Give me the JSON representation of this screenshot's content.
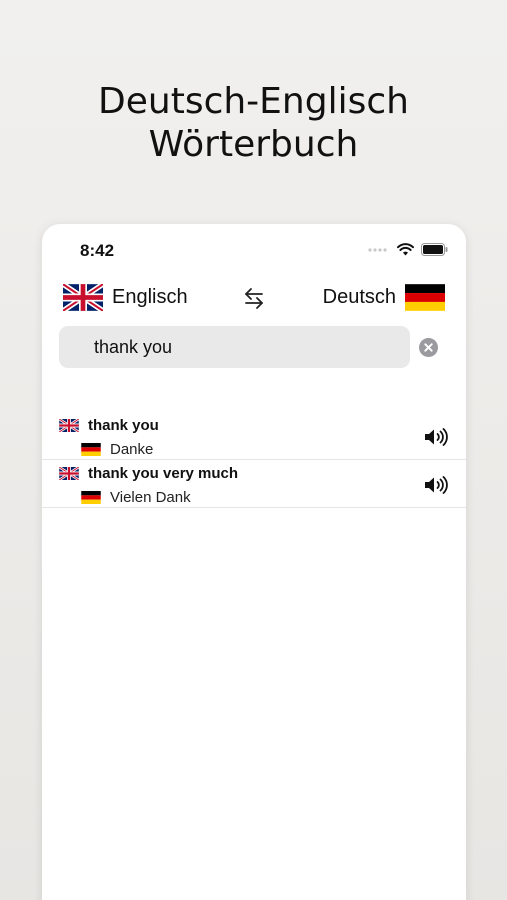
{
  "headline": {
    "line1": "Deutsch-Englisch",
    "line2": "Wörterbuch"
  },
  "status": {
    "time": "8:42"
  },
  "languages": {
    "source": "Englisch",
    "target": "Deutsch"
  },
  "search": {
    "value": "thank you"
  },
  "results": [
    {
      "source": "thank you",
      "target": "Danke"
    },
    {
      "source": "thank you very much",
      "target": "Vielen Dank"
    }
  ],
  "colors": {
    "uk_blue": "#012169",
    "uk_red": "#C8102E",
    "de_black": "#000000",
    "de_red": "#DD0000",
    "de_gold": "#FFCE00"
  },
  "icons": [
    "wifi-icon",
    "battery-icon",
    "swap-icon",
    "clear-icon",
    "speaker-icon",
    "uk-flag-icon",
    "de-flag-icon"
  ]
}
